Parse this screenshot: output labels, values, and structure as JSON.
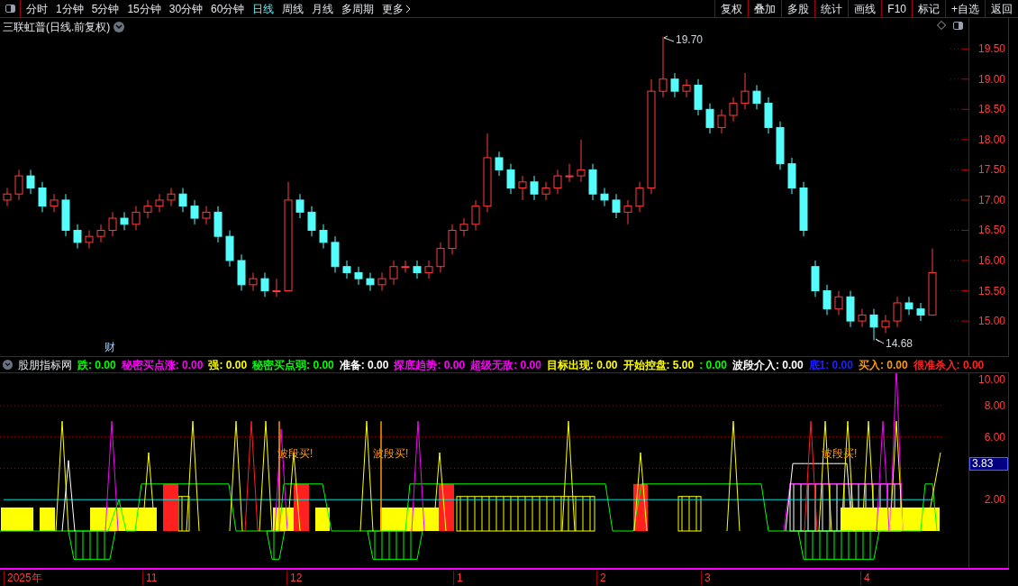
{
  "toolbar": {
    "periods": [
      {
        "label": "分时",
        "selected": false
      },
      {
        "label": "1分钟",
        "selected": false
      },
      {
        "label": "5分钟",
        "selected": false
      },
      {
        "label": "15分钟",
        "selected": false
      },
      {
        "label": "30分钟",
        "selected": false
      },
      {
        "label": "60分钟",
        "selected": false
      },
      {
        "label": "日线",
        "selected": true
      },
      {
        "label": "周线",
        "selected": false
      },
      {
        "label": "月线",
        "selected": false
      },
      {
        "label": "多周期",
        "selected": false
      }
    ],
    "more": "更多",
    "actions": [
      "复权",
      "叠加",
      "多股",
      "统计",
      "画线",
      "F10",
      "标记",
      "+自选",
      "返回"
    ]
  },
  "main_chart": {
    "title": "三联虹普(日线.前复权)",
    "high_label": "19.70",
    "low_label": "14.68",
    "event_marker": "财",
    "chart_data": {
      "type": "candlestick",
      "ylim": [
        14.42,
        20.01
      ],
      "yticks": [
        {
          "value": 19.5,
          "label": "19.50"
        },
        {
          "value": 19,
          "label": "19.00"
        },
        {
          "value": 18.5,
          "label": "18.50"
        },
        {
          "value": 18,
          "label": "18.00"
        },
        {
          "value": 17.5,
          "label": "17.50"
        },
        {
          "value": 17,
          "label": "17.00"
        },
        {
          "value": 16.5,
          "label": "16.50"
        },
        {
          "value": 16,
          "label": "16.00"
        },
        {
          "value": 15.5,
          "label": "15.50"
        },
        {
          "value": 15,
          "label": "15.00"
        }
      ],
      "ohlc": [
        [
          17.0,
          17.2,
          16.9,
          17.1
        ],
        [
          17.1,
          17.5,
          17.0,
          17.4
        ],
        [
          17.4,
          17.5,
          17.1,
          17.2
        ],
        [
          17.2,
          17.3,
          16.8,
          16.9
        ],
        [
          16.9,
          17.1,
          16.8,
          17.0
        ],
        [
          17.0,
          17.1,
          16.4,
          16.5
        ],
        [
          16.5,
          16.6,
          16.2,
          16.3
        ],
        [
          16.3,
          16.5,
          16.2,
          16.4
        ],
        [
          16.4,
          16.6,
          16.3,
          16.5
        ],
        [
          16.5,
          16.8,
          16.4,
          16.7
        ],
        [
          16.7,
          16.8,
          16.5,
          16.6
        ],
        [
          16.6,
          16.9,
          16.5,
          16.8
        ],
        [
          16.8,
          17.0,
          16.7,
          16.9
        ],
        [
          16.9,
          17.1,
          16.8,
          17.0
        ],
        [
          17.0,
          17.2,
          16.9,
          17.1
        ],
        [
          17.1,
          17.2,
          16.8,
          16.9
        ],
        [
          16.9,
          17.0,
          16.6,
          16.7
        ],
        [
          16.7,
          16.9,
          16.6,
          16.8
        ],
        [
          16.8,
          16.9,
          16.3,
          16.4
        ],
        [
          16.4,
          16.5,
          15.9,
          16.0
        ],
        [
          16.0,
          16.1,
          15.5,
          15.6
        ],
        [
          15.6,
          15.8,
          15.5,
          15.7
        ],
        [
          15.7,
          15.8,
          15.4,
          15.5
        ],
        [
          15.5,
          15.7,
          15.4,
          15.5
        ],
        [
          15.5,
          17.3,
          15.5,
          17.0
        ],
        [
          17.0,
          17.1,
          16.7,
          16.8
        ],
        [
          16.8,
          16.9,
          16.4,
          16.5
        ],
        [
          16.5,
          16.6,
          16.2,
          16.3
        ],
        [
          16.3,
          16.4,
          15.8,
          15.9
        ],
        [
          15.9,
          16.0,
          15.7,
          15.8
        ],
        [
          15.8,
          15.9,
          15.6,
          15.7
        ],
        [
          15.7,
          15.8,
          15.5,
          15.6
        ],
        [
          15.6,
          15.8,
          15.5,
          15.7
        ],
        [
          15.7,
          16.0,
          15.6,
          15.9
        ],
        [
          15.9,
          16.0,
          15.8,
          15.9
        ],
        [
          15.9,
          16.0,
          15.7,
          15.8
        ],
        [
          15.8,
          16.0,
          15.7,
          15.9
        ],
        [
          15.9,
          16.3,
          15.8,
          16.2
        ],
        [
          16.2,
          16.6,
          16.1,
          16.5
        ],
        [
          16.5,
          16.7,
          16.4,
          16.6
        ],
        [
          16.6,
          17.0,
          16.5,
          16.9
        ],
        [
          16.9,
          18.1,
          16.8,
          17.7
        ],
        [
          17.7,
          17.8,
          17.4,
          17.5
        ],
        [
          17.5,
          17.6,
          17.1,
          17.2
        ],
        [
          17.2,
          17.4,
          17.0,
          17.3
        ],
        [
          17.3,
          17.4,
          17.0,
          17.1
        ],
        [
          17.1,
          17.3,
          17.0,
          17.2
        ],
        [
          17.2,
          17.5,
          17.1,
          17.4
        ],
        [
          17.4,
          17.6,
          17.3,
          17.4
        ],
        [
          17.4,
          18.0,
          17.3,
          17.5
        ],
        [
          17.5,
          17.6,
          17.0,
          17.1
        ],
        [
          17.1,
          17.2,
          16.9,
          17.0
        ],
        [
          17.0,
          17.1,
          16.7,
          16.8
        ],
        [
          16.8,
          17.0,
          16.6,
          16.9
        ],
        [
          16.9,
          17.3,
          16.8,
          17.2
        ],
        [
          17.2,
          19.0,
          17.1,
          18.8
        ],
        [
          18.8,
          19.7,
          18.7,
          19.0
        ],
        [
          19.0,
          19.1,
          18.7,
          18.8
        ],
        [
          18.8,
          19.0,
          18.7,
          18.9
        ],
        [
          18.9,
          19.0,
          18.4,
          18.5
        ],
        [
          18.5,
          18.6,
          18.1,
          18.2
        ],
        [
          18.2,
          18.5,
          18.1,
          18.4
        ],
        [
          18.4,
          18.7,
          18.3,
          18.6
        ],
        [
          18.6,
          19.1,
          18.5,
          18.8
        ],
        [
          18.8,
          18.9,
          18.5,
          18.6
        ],
        [
          18.6,
          18.7,
          18.1,
          18.2
        ],
        [
          18.2,
          18.3,
          17.5,
          17.6
        ],
        [
          17.6,
          17.7,
          17.1,
          17.2
        ],
        [
          17.2,
          17.3,
          16.4,
          16.5
        ],
        [
          15.9,
          16.0,
          15.4,
          15.5
        ],
        [
          15.5,
          15.6,
          15.1,
          15.2
        ],
        [
          15.2,
          15.5,
          15.1,
          15.4
        ],
        [
          15.4,
          15.5,
          14.9,
          15.0
        ],
        [
          15.0,
          15.2,
          14.9,
          15.1
        ],
        [
          15.1,
          15.2,
          14.68,
          14.9
        ],
        [
          14.9,
          15.1,
          14.8,
          15.0
        ],
        [
          15.0,
          15.4,
          14.9,
          15.3
        ],
        [
          15.3,
          15.4,
          15.1,
          15.2
        ],
        [
          15.2,
          15.3,
          15.0,
          15.1
        ],
        [
          15.1,
          16.2,
          15.1,
          15.8
        ]
      ]
    }
  },
  "indicator": {
    "name": "股朋指标网",
    "values": [
      {
        "text": "跌: 0.00",
        "color": "#00ff00"
      },
      {
        "text": "秘密买点涨: 0.00",
        "color": "#ff00ff"
      },
      {
        "text": "强: 0.00",
        "color": "#ffff00"
      },
      {
        "text": "秘密买点弱: 0.00",
        "color": "#00ff00"
      },
      {
        "text": "准备: 0.00",
        "color": "#ffffff"
      },
      {
        "text": "探底趋势: 0.00",
        "color": "#ff00ff"
      },
      {
        "text": "超级无敌: 0.00",
        "color": "#ff00ff"
      },
      {
        "text": "目标出现: 0.00",
        "color": "#ffff00"
      },
      {
        "text": "开始控盘: 5.00",
        "color": "#ffff00"
      },
      {
        "text": ": 0.00",
        "color": "#00ff00"
      },
      {
        "text": "波段介入: 0.00",
        "color": "#ffffff"
      },
      {
        "text": "底1: 0.00",
        "color": "#2020ff"
      },
      {
        "text": "买入: 0.00",
        "color": "#ff9900"
      },
      {
        "text": "很准杀入: 0.00",
        "color": "#ff2020"
      }
    ],
    "axis": [
      "10.00",
      "8.00",
      "6.00",
      "2.00"
    ],
    "current_value": "3.83",
    "signals": [
      "波段买!",
      "波段买!",
      "波段买!"
    ]
  },
  "time_axis": [
    "2025年",
    "11",
    "12",
    "1",
    "2",
    "3",
    "4"
  ]
}
